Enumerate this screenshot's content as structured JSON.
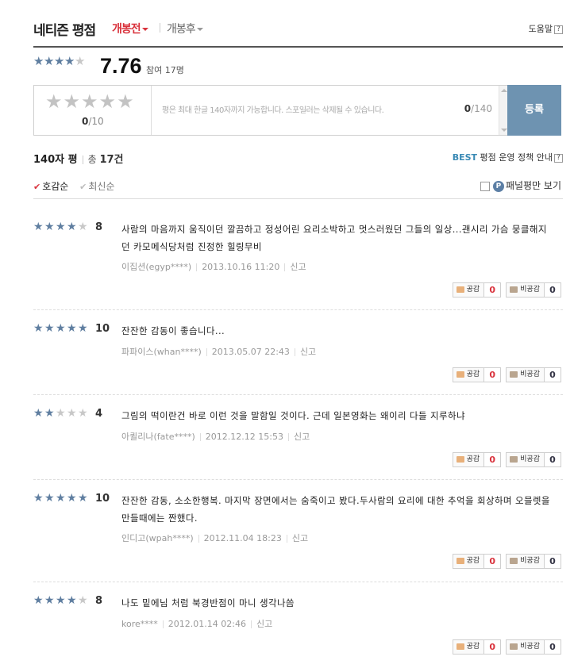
{
  "header": {
    "title": "네티즌 평점",
    "tab_before": "개봉전",
    "tab_after": "개봉후",
    "help": "도움말",
    "help_icon": "?"
  },
  "score": {
    "value": "7.76",
    "stars_filled": 4,
    "participants": "참여 17명"
  },
  "input": {
    "stars_count": "0",
    "stars_max": "/10",
    "placeholder": "평은 최대 한글 140자까지 가능합니다. 스포일러는 삭제될 수 있습니다.",
    "char_count": "0",
    "char_max": "/140",
    "submit": "등록"
  },
  "list": {
    "title": "140자 평",
    "total_label": "총",
    "total_count": "17건",
    "best": "BEST",
    "policy": "평점 운영 정책 안내",
    "sort_good": "호감순",
    "sort_new": "최신순",
    "panel_only": "패널평만 보기",
    "panel_badge": "P"
  },
  "vote_labels": {
    "like": "공감",
    "dislike": "비공감",
    "report": "신고"
  },
  "reviews": [
    {
      "stars": 4,
      "score": "8",
      "text": "사람의 마음까지 움직이던 깔끔하고 정성어린 요리소박하고 멋스러웠던 그들의 일상...괜시리 가슴 뭉클해지던 카모메식당처럼 진정한 힐링무비",
      "user": "이집션(egyp****)",
      "date": "2013.10.16 11:20",
      "like": "0",
      "dislike": "0"
    },
    {
      "stars": 5,
      "score": "10",
      "text": "잔잔한 감동이 좋습니다...",
      "user": "파파이스(whan****)",
      "date": "2013.05.07 22:43",
      "like": "0",
      "dislike": "0"
    },
    {
      "stars": 2,
      "score": "4",
      "text": "그림의 떡이란건 바로 이런 것을 말함일 것이다. 근데 일본영화는 왜이리 다들 지루하냐",
      "user": "아퀼리나(fate****)",
      "date": "2012.12.12 15:53",
      "like": "0",
      "dislike": "0"
    },
    {
      "stars": 5,
      "score": "10",
      "text": "잔잔한 감동, 소소한행복. 마지막 장면에서는 숨죽이고 봤다.두사람의 요리에 대한 추억을 회상하며 오믈렛을 만들때에는 짠했다.",
      "user": "인디고(wpah****)",
      "date": "2012.11.04 18:23",
      "like": "0",
      "dislike": "0"
    },
    {
      "stars": 4,
      "score": "8",
      "text": "나도 밑에님 처럼 북경반점이 마니 생각나씀",
      "user": "kore****",
      "date": "2012.01.14 02:46",
      "like": "0",
      "dislike": "0"
    }
  ]
}
